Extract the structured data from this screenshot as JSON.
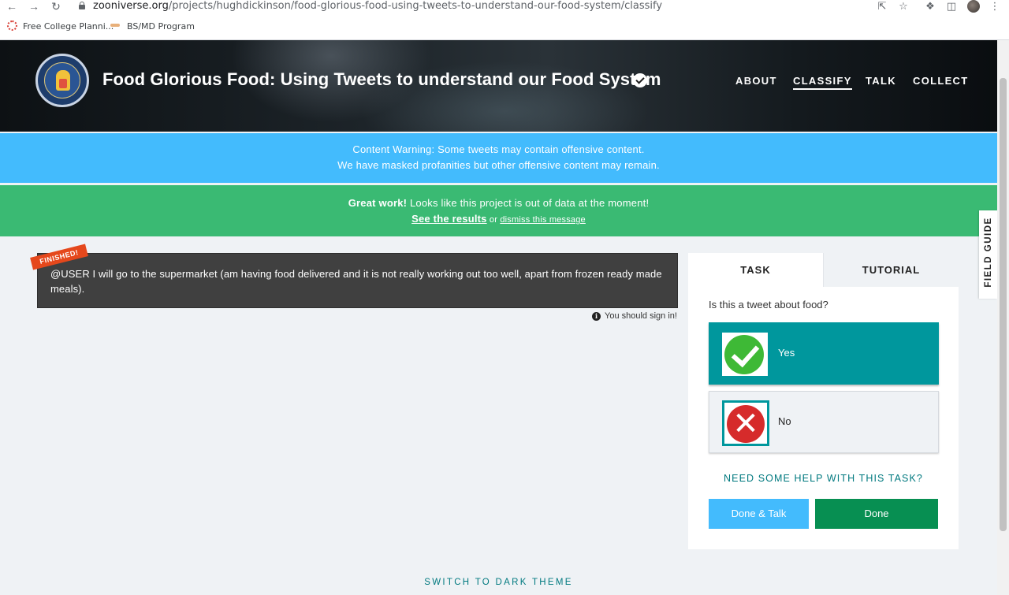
{
  "browser": {
    "url_host": "zooniverse.org",
    "url_path": "/projects/hughdickinson/food-glorious-food-using-tweets-to-understand-our-food-system/classify",
    "bookmarks": [
      "Free College Planni...",
      "BS/MD Program"
    ]
  },
  "header": {
    "title": "Food Glorious Food: Using Tweets to understand our Food System",
    "nav": [
      "ABOUT",
      "CLASSIFY",
      "TALK",
      "COLLECT"
    ],
    "active_nav": "CLASSIFY"
  },
  "warning_banner": {
    "line1": "Content Warning: Some tweets may contain offensive content.",
    "line2": "We have masked profanities but other offensive content may remain."
  },
  "finished_banner": {
    "strong": "Great work!",
    "text": " Looks like this project is out of data at the moment!",
    "results_link": "See the results",
    "or": " or ",
    "dismiss_link": "dismiss this message"
  },
  "subject": {
    "badge": "FINISHED!",
    "text": "@USER I will go to the supermarket (am having food delivered and it is not really working out too well, apart from frozen ready made meals).",
    "signin_note": "You should sign in!"
  },
  "task_panel": {
    "tabs": [
      "TASK",
      "TUTORIAL"
    ],
    "active_tab": "TASK",
    "question": "Is this a tweet about food?",
    "answers": [
      {
        "label": "Yes",
        "icon": "check-icon",
        "selected": true
      },
      {
        "label": "No",
        "icon": "x-icon",
        "selected": false
      }
    ],
    "help_link": "NEED SOME HELP WITH THIS TASK?",
    "done_talk_label": "Done & Talk",
    "done_label": "Done"
  },
  "field_guide_label": "FIELD GUIDE",
  "footer_link": "SWITCH TO DARK THEME",
  "colors": {
    "warning_blue": "#43bbfd",
    "success_green": "#3aba73",
    "teal": "#00979d",
    "done_green": "#078f52"
  }
}
